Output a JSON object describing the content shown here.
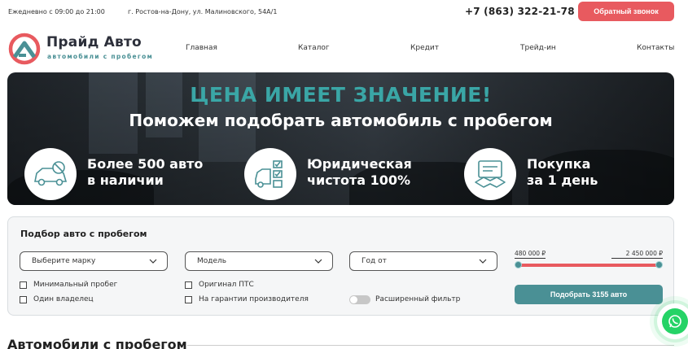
{
  "topbar": {
    "hours": "Ежедневно с 09:00 до 21:00",
    "address": "г. Ростов-на-Дону, ул. Малиновского, 54А/1",
    "phone": "+7 (863) 322-21-78",
    "callback_label": "Обратный звонок"
  },
  "brand": {
    "name": "Прайд Авто",
    "tagline": "автомобили с пробегом"
  },
  "nav": {
    "items": [
      "Главная",
      "Каталог",
      "Кредит",
      "Трейд-ин",
      "Контакты"
    ]
  },
  "banner": {
    "headline": "ЦЕНА ИМЕЕТ ЗНАЧЕНИЕ!",
    "subline": "Поможем подобрать автомобиль с пробегом",
    "features": [
      {
        "icon": "car-icon",
        "line1": "Более 500 авто",
        "line2": "в наличии"
      },
      {
        "icon": "checklist-car-icon",
        "line1": "Юридическая",
        "line2": "чистота 100%"
      },
      {
        "icon": "handshake-contract-icon",
        "line1": "Покупка",
        "line2": "за 1 день"
      }
    ]
  },
  "filter": {
    "title": "Подбор авто с пробегом",
    "brand_select": "Выберите марку",
    "model_select": "Модель",
    "year_select": "Год от",
    "price_min": "480 000 ₽",
    "price_max": "2 450 000 ₽",
    "range_fraction": [
      0.0,
      1.0
    ],
    "checkboxes": [
      "Минимальный пробег",
      "Один владелец",
      "Оригинал ПТС",
      "На гарантии производителя"
    ],
    "toggle_label": "Расширенный фильтр",
    "search_button": "Подобрать 3155 авто"
  },
  "section": {
    "title": "Автомобили с пробегом"
  },
  "colors": {
    "accent_red": "#e85a5f",
    "accent_teal": "#4a9095",
    "headline_teal": "#3aa6a6",
    "whatsapp": "#25d366"
  }
}
